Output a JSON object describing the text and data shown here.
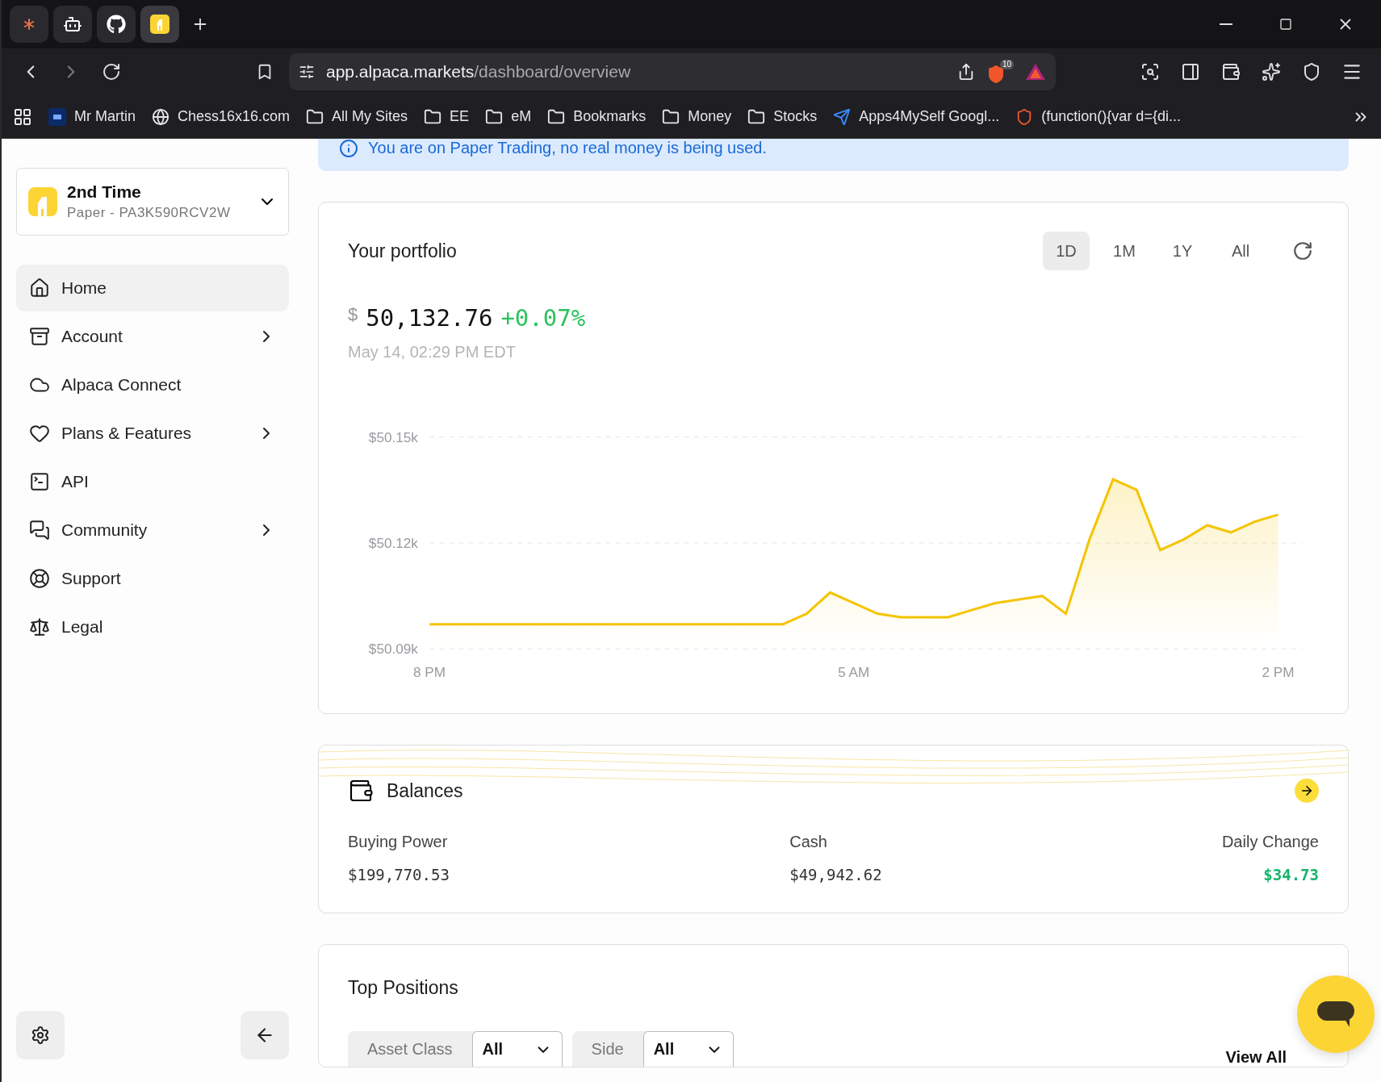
{
  "browser": {
    "tabs": [
      {
        "kind": "burst",
        "selected": false
      },
      {
        "kind": "bot",
        "selected": false
      },
      {
        "kind": "github",
        "selected": false
      },
      {
        "kind": "alpaca",
        "selected": true
      }
    ],
    "url_host": "app.alpaca.markets",
    "url_path": "/dashboard/overview",
    "shield_count": "10",
    "bookmarks": [
      {
        "kind": "ai",
        "label": "Mr Martin"
      },
      {
        "kind": "globe",
        "label": "Chess16x16.com"
      },
      {
        "kind": "folder",
        "label": "All My Sites"
      },
      {
        "kind": "folder",
        "label": "EE"
      },
      {
        "kind": "folder",
        "label": "eM"
      },
      {
        "kind": "folder",
        "label": "Bookmarks"
      },
      {
        "kind": "folder",
        "label": "Money"
      },
      {
        "kind": "folder",
        "label": "Stocks"
      },
      {
        "kind": "app",
        "label": "Apps4MySelf Googl..."
      },
      {
        "kind": "brave",
        "label": "(function(){var d={di..."
      }
    ]
  },
  "sidebar": {
    "account": {
      "name": "2nd Time",
      "detail": "Paper - PA3K590RCV2W"
    },
    "items": [
      {
        "label": "Home",
        "selected": true,
        "submenu": false
      },
      {
        "label": "Account",
        "selected": false,
        "submenu": true
      },
      {
        "label": "Alpaca Connect",
        "selected": false,
        "submenu": false
      },
      {
        "label": "Plans & Features",
        "selected": false,
        "submenu": true
      },
      {
        "label": "API",
        "selected": false,
        "submenu": false
      },
      {
        "label": "Community",
        "selected": false,
        "submenu": true
      },
      {
        "label": "Support",
        "selected": false,
        "submenu": false
      },
      {
        "label": "Legal",
        "selected": false,
        "submenu": false
      }
    ]
  },
  "banner": "You are on Paper Trading, no real money is being used.",
  "portfolio": {
    "title": "Your portfolio",
    "ranges": [
      {
        "label": "1D",
        "selected": true
      },
      {
        "label": "1M",
        "selected": false
      },
      {
        "label": "1Y",
        "selected": false
      },
      {
        "label": "All",
        "selected": false
      }
    ],
    "currency": "$",
    "value": "50,132.76",
    "change": "+0.07%",
    "timestamp": "May 14, 02:29 PM EDT",
    "chart_data": {
      "type": "area",
      "categories": [
        "8 PM",
        null,
        null,
        null,
        null,
        null,
        null,
        null,
        null,
        null,
        null,
        null,
        null,
        null,
        null,
        null,
        null,
        null,
        "5 AM",
        null,
        null,
        null,
        null,
        null,
        null,
        null,
        null,
        null,
        null,
        null,
        null,
        null,
        null,
        null,
        null,
        null,
        "2 PM"
      ],
      "series": [
        {
          "color": "#f5c400",
          "values": [
            50097,
            50097,
            50097,
            50097,
            50097,
            50097,
            50097,
            50097,
            50097,
            50097,
            50097,
            50097,
            50097,
            50097,
            50097,
            50097,
            50100,
            50106,
            50103,
            50100,
            50099,
            50099,
            50099,
            50101,
            50103,
            50104,
            50105,
            50100,
            50121,
            50138,
            50135,
            50118,
            50121,
            50125,
            50123,
            50126,
            50128
          ]
        }
      ],
      "ylim": [
        50090,
        50150
      ],
      "yticks": [
        {
          "value": 50150,
          "label": "$50.15k"
        },
        {
          "value": 50120,
          "label": "$50.12k"
        },
        {
          "value": 50090,
          "label": "$50.09k"
        }
      ]
    }
  },
  "balances": {
    "title": "Balances",
    "columns": [
      {
        "label": "Buying Power",
        "value": "$199,770.53",
        "positive": false
      },
      {
        "label": "Cash",
        "value": "$49,942.62",
        "positive": false
      },
      {
        "label": "Daily Change",
        "value": "$34.73",
        "positive": true
      }
    ]
  },
  "positions": {
    "title": "Top Positions",
    "filters": [
      {
        "label": "Asset Class",
        "value": "All"
      },
      {
        "label": "Side",
        "value": "All"
      }
    ],
    "link": "View All"
  }
}
